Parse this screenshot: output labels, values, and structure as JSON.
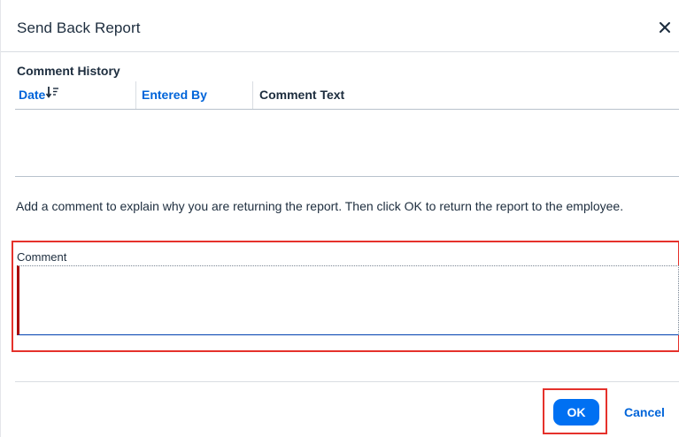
{
  "dialog": {
    "title": "Send Back Report",
    "close_icon": "close-icon"
  },
  "history": {
    "label": "Comment History",
    "columns": [
      {
        "label": "Date",
        "sort_icon": "sort-descending-icon",
        "link": true
      },
      {
        "label": "Entered By",
        "link": true
      },
      {
        "label": "Comment Text",
        "link": false
      }
    ],
    "rows": []
  },
  "instructions": "Add a comment to explain why you are returning the report. Then click OK to return the report to the employee.",
  "comment": {
    "label": "Comment",
    "value": "",
    "placeholder": ""
  },
  "footer": {
    "ok_label": "OK",
    "cancel_label": "Cancel"
  },
  "colors": {
    "accent": "#0070f2",
    "link": "#0064d9",
    "highlight": "#e5312b",
    "error_border": "#aa0808"
  }
}
